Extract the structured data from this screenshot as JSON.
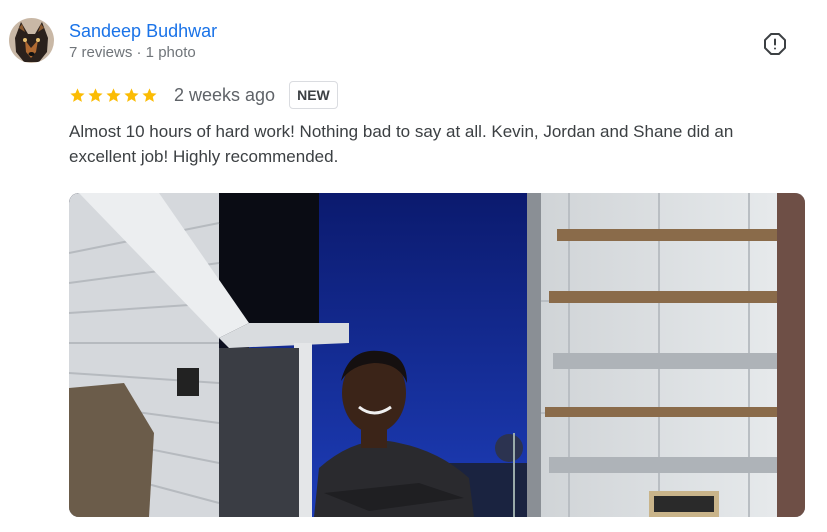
{
  "review": {
    "author": {
      "name": "Sandeep Budhwar",
      "meta": "7 reviews · 1 photo",
      "avatar_icon": "dog-avatar"
    },
    "rating": 5,
    "stars_icon": "star-icon",
    "time_ago": "2 weeks ago",
    "badge": "NEW",
    "text": "Almost 10 hours of hard work! Nothing bad to say at all. Kevin, Jordan and Shane did an excellent job! Highly recommended.",
    "report_icon": "report-icon",
    "photo": {
      "icon": "review-photo"
    }
  },
  "colors": {
    "author_link": "#1a73e8",
    "star": "#fbbc04",
    "meta": "#70757a"
  }
}
